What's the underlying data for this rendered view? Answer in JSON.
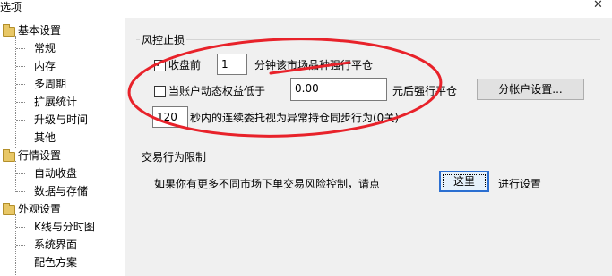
{
  "window": {
    "title": "选项"
  },
  "tree": {
    "groups": [
      {
        "label": "基本设置",
        "items": [
          "常规",
          "内存",
          "多周期",
          "扩展统计",
          "升级与时间",
          "其他"
        ]
      },
      {
        "label": "行情设置",
        "items": [
          "自动收盘",
          "数据与存储"
        ]
      },
      {
        "label": "外观设置",
        "items": [
          "K线与分时图",
          "系统界面",
          "配色方案"
        ]
      }
    ]
  },
  "risk": {
    "group_title": "风控止损",
    "close_before": {
      "checked": true,
      "label": "收盘前",
      "value": "1",
      "suffix": "分钟该市场品种强行平仓"
    },
    "equity_below": {
      "checked": false,
      "label": "当账户动态权益低于",
      "value": "0.00",
      "suffix": "元后强行平仓"
    },
    "account_button": "分帐户设置...",
    "sync": {
      "value": "120",
      "suffix": "秒内的连续委托视为异常持仓同步行为(0关)"
    }
  },
  "trade_limit": {
    "group_title": "交易行为限制",
    "text": "如果你有更多不同市场下单交易风险控制，请点",
    "button": "这里",
    "after": "进行设置"
  },
  "colors": {
    "annotation": "#e8222a",
    "focus_blue": "#2b6fd1",
    "folder": "#e8c766"
  }
}
